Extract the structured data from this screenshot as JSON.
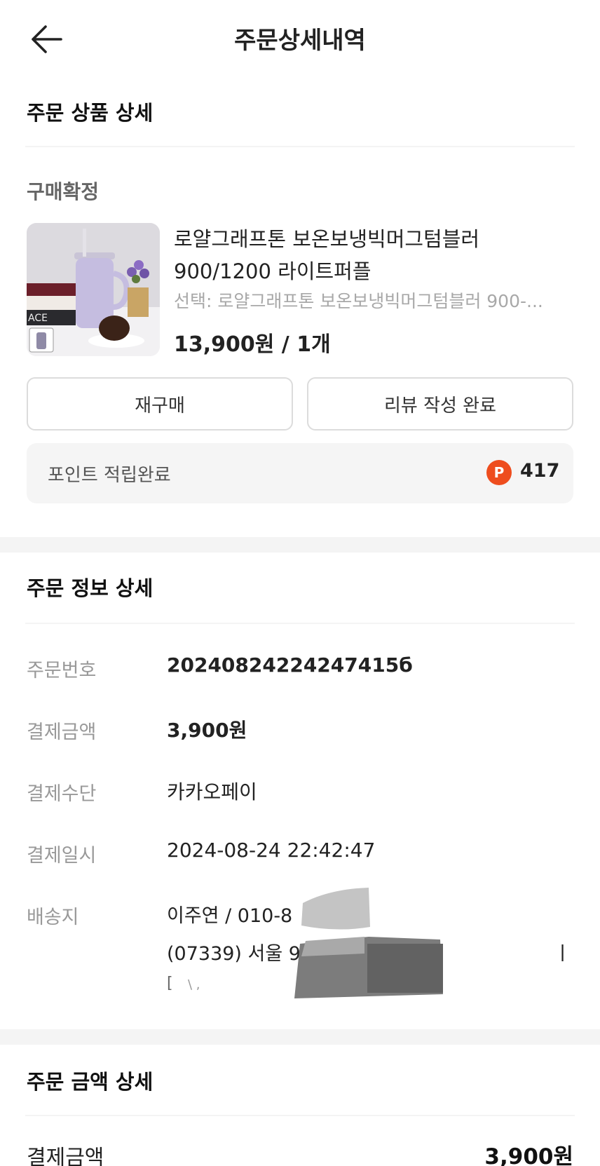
{
  "header": {
    "title": "주문상세내역",
    "back_icon": "arrow-left-icon"
  },
  "product_section": {
    "title": "주문 상품 상세",
    "status": "구매확정",
    "product": {
      "name": "로얄그래프톤 보온보냉빅머그텀블러 900/1200 라이트퍼플",
      "option": "선택: 로얄그래프톤 보온보냉빅머그텀블러 900-...",
      "price_qty": "13,900원 / 1개",
      "thumb_book_text": "ACE"
    },
    "buttons": {
      "rebuy": "재구매",
      "review": "리뷰 작성 완료"
    },
    "points": {
      "label": "포인트 적립완료",
      "icon_letter": "P",
      "value": "417",
      "icon_color": "#ee4d1e"
    }
  },
  "order_info": {
    "title": "주문 정보 상세",
    "rows": [
      {
        "label": "주문번호",
        "value": "20240824224247415б"
      },
      {
        "label": "결제금액",
        "value": "3,900원"
      },
      {
        "label": "결제수단",
        "value": "카카오페이"
      },
      {
        "label": "결제일시",
        "value": "2024-08-24 22:42:47"
      }
    ],
    "shipping": {
      "label": "배송지",
      "line1": "이주연 / 010-8",
      "line2": "(07339) 서울 9",
      "line2_tail": "ㅣ",
      "line3": "[",
      "line3_tail": "\\ ,"
    }
  },
  "amount_section": {
    "title": "주문 금액 상세",
    "total_label": "결제금액",
    "total_value": "3,900원"
  }
}
